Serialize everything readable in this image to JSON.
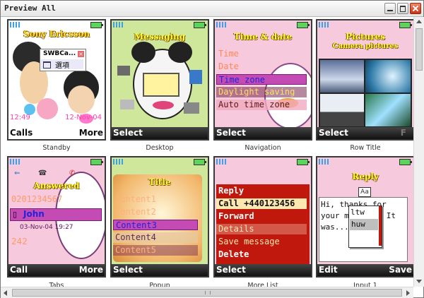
{
  "window": {
    "title": "Preview All"
  },
  "tiles": {
    "standby": {
      "caption": "Standby",
      "header": "Sony Ericsson",
      "popup_title": "SWBCa...",
      "popup_item": "選項",
      "time": "12:49",
      "date": "12-Nov-04",
      "left": "Calls",
      "right": "More"
    },
    "desktop": {
      "caption": "Desktop",
      "header": "Messaging",
      "left": "Select"
    },
    "navigation": {
      "caption": "Navigation",
      "header": "Time & date",
      "items": [
        "Time",
        "Date",
        "Time zone",
        "Daylight saving",
        "Auto time zone"
      ],
      "left": "Select"
    },
    "row_title": {
      "caption": "Row Title",
      "header": "Pictures",
      "subheader": "Camera pictures",
      "left": "Select",
      "right": "F"
    },
    "tabs": {
      "caption": "Tabs",
      "header": "Answered",
      "number": "0201234567",
      "contact": "John",
      "datetime": "03-Nov-04 19:27",
      "count": "242",
      "left": "Call",
      "right": "More"
    },
    "popup": {
      "caption": "Popup",
      "header": "Title",
      "items": [
        "Content1",
        "Content2",
        "Content3",
        "Content4",
        "Content5"
      ],
      "left": "Select"
    },
    "more_list": {
      "caption": "More List",
      "items": [
        "Reply",
        "Call +440123456",
        "Forward",
        "Details",
        "Save message",
        "Delete"
      ],
      "left": "Select"
    },
    "input1": {
      "caption": "Input 1",
      "header": "Reply",
      "mode": "Aa",
      "message": "Hi, thanks for your message. It was...",
      "suggestions": [
        "ltw",
        "huw"
      ],
      "left": "Edit",
      "right": "Save"
    }
  },
  "colors": {
    "tile_pink": "#f7c9dc",
    "menu_red": "#c0180c",
    "menu_cream": "#fde8b0",
    "highlight_purple": "#b04aa8",
    "header_yellow": "#ffff33"
  }
}
